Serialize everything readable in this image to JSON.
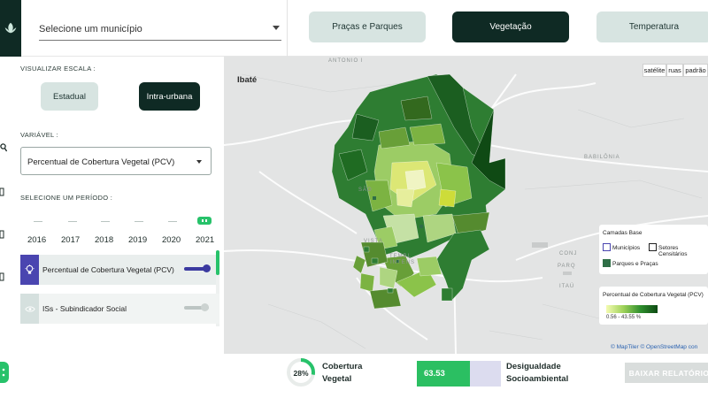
{
  "header": {
    "municipio_placeholder": "Selecione um município",
    "tabs": [
      {
        "label": "Praças e Parques",
        "active": false
      },
      {
        "label": "Vegetação",
        "active": true
      },
      {
        "label": "Temperatura",
        "active": false
      }
    ]
  },
  "sidebar": {
    "scale_label": "VISUALIZAR ESCALA :",
    "scale_options": [
      {
        "label": "Estadual",
        "active": false
      },
      {
        "label": "Intra-urbana",
        "active": true
      }
    ],
    "variable_label": "VARIÁVEL :",
    "variable_value": "Percentual de Cobertura Vegetal (PCV)",
    "period_label": "SELECIONE UM PERÍODO :",
    "years": [
      "2016",
      "2017",
      "2018",
      "2019",
      "2020",
      "2021"
    ],
    "selected_year": "2021",
    "layers": [
      {
        "label": "Percentual de Cobertura Vegetal (PCV)",
        "enabled": true
      },
      {
        "label": "ISs - Subindicador Social",
        "enabled": false
      }
    ]
  },
  "map": {
    "place_labels": {
      "ibate": "Ibaté",
      "antonio": "ANTONIO I",
      "babilonia": "BABILÔNIA",
      "conj": "CONJ",
      "paraq": "PARQ",
      "itauj": "ITAÚ",
      "sao": "SÃO",
      "vista": "VISTA",
      "tembl": "TEMBL",
      "intens": "INTENS"
    },
    "view_buttons": [
      "satélite",
      "ruas",
      "padrão"
    ],
    "legend_base": {
      "title": "Camadas Base",
      "items": [
        "Municípios",
        "Setores Censitários",
        "Parques e Praças"
      ]
    },
    "legend_pcv": {
      "title": "Percentual de Cobertura Vegetal (PCV)",
      "range": "0.56 - 43.55 %"
    },
    "attribution": "© MapTiler © OpenStreetMap con"
  },
  "kpis": {
    "cobertura_value": "28%",
    "cobertura_fraction": 0.28,
    "cobertura_label_1": "Cobertura",
    "cobertura_label_2": "Vegetal",
    "desigualdade_value": "63.53",
    "desigualdade_fraction": 0.6353,
    "desigualdade_label_1": "Desigualdade",
    "desigualdade_label_2": "Socioambiental",
    "report_button": "BAIXAR RELATÓRIO"
  },
  "colors": {
    "dark": "#0f2a24",
    "light_tab": "#d7e4e1",
    "accent_green": "#27c26a",
    "indigo": "#4a45b0"
  }
}
